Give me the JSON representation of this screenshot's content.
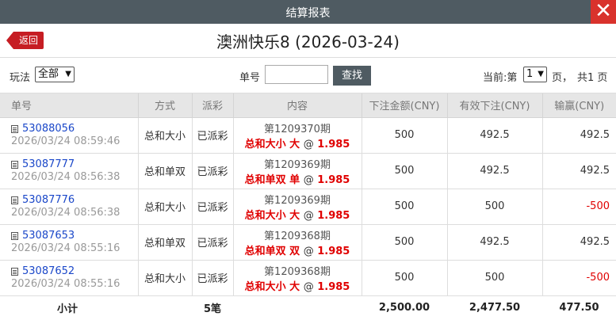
{
  "window": {
    "title": "结算报表",
    "close_glyph": "✕"
  },
  "back_label": "返回",
  "heading": "澳洲快乐8 (2026-03-24)",
  "filters": {
    "play_label": "玩法",
    "play_value": "全部",
    "order_label": "单号",
    "order_value": "",
    "search_label": "查找",
    "current_label": "当前:第",
    "page_value": "1",
    "page_suffix": "页，",
    "total_pages": "共1 页"
  },
  "columns": [
    "单号",
    "方式",
    "派彩",
    "内容",
    "下注金额(CNY)",
    "有效下注(CNY)",
    "输赢(CNY)"
  ],
  "rows": [
    {
      "id": "53088056",
      "time": "2026/03/24 08:59:46",
      "method": "总和大小",
      "status": "已派彩",
      "period": "第1209370期",
      "bet": "总和大小 大",
      "at": "@",
      "odds": "1.985",
      "amount": "500",
      "valid": "492.5",
      "result": "492.5"
    },
    {
      "id": "53087777",
      "time": "2026/03/24 08:56:38",
      "method": "总和单双",
      "status": "已派彩",
      "period": "第1209369期",
      "bet": "总和单双 单",
      "at": "@",
      "odds": "1.985",
      "amount": "500",
      "valid": "492.5",
      "result": "492.5"
    },
    {
      "id": "53087776",
      "time": "2026/03/24 08:56:38",
      "method": "总和大小",
      "status": "已派彩",
      "period": "第1209369期",
      "bet": "总和大小 大",
      "at": "@",
      "odds": "1.985",
      "amount": "500",
      "valid": "500",
      "result": "-500"
    },
    {
      "id": "53087653",
      "time": "2026/03/24 08:55:16",
      "method": "总和单双",
      "status": "已派彩",
      "period": "第1209368期",
      "bet": "总和单双 双",
      "at": "@",
      "odds": "1.985",
      "amount": "500",
      "valid": "492.5",
      "result": "492.5"
    },
    {
      "id": "53087652",
      "time": "2026/03/24 08:55:16",
      "method": "总和大小",
      "status": "已派彩",
      "period": "第1209368期",
      "bet": "总和大小 大",
      "at": "@",
      "odds": "1.985",
      "amount": "500",
      "valid": "500",
      "result": "-500"
    }
  ],
  "totals": {
    "label": "小计",
    "count": "5笔",
    "amount": "2,500.00",
    "valid": "2,477.50",
    "result": "477.50"
  },
  "colors": {
    "titlebar": "#4f5b62",
    "close": "#d9322c",
    "back": "#c61d23",
    "link": "#1a47c9",
    "negative": "#e00000"
  }
}
